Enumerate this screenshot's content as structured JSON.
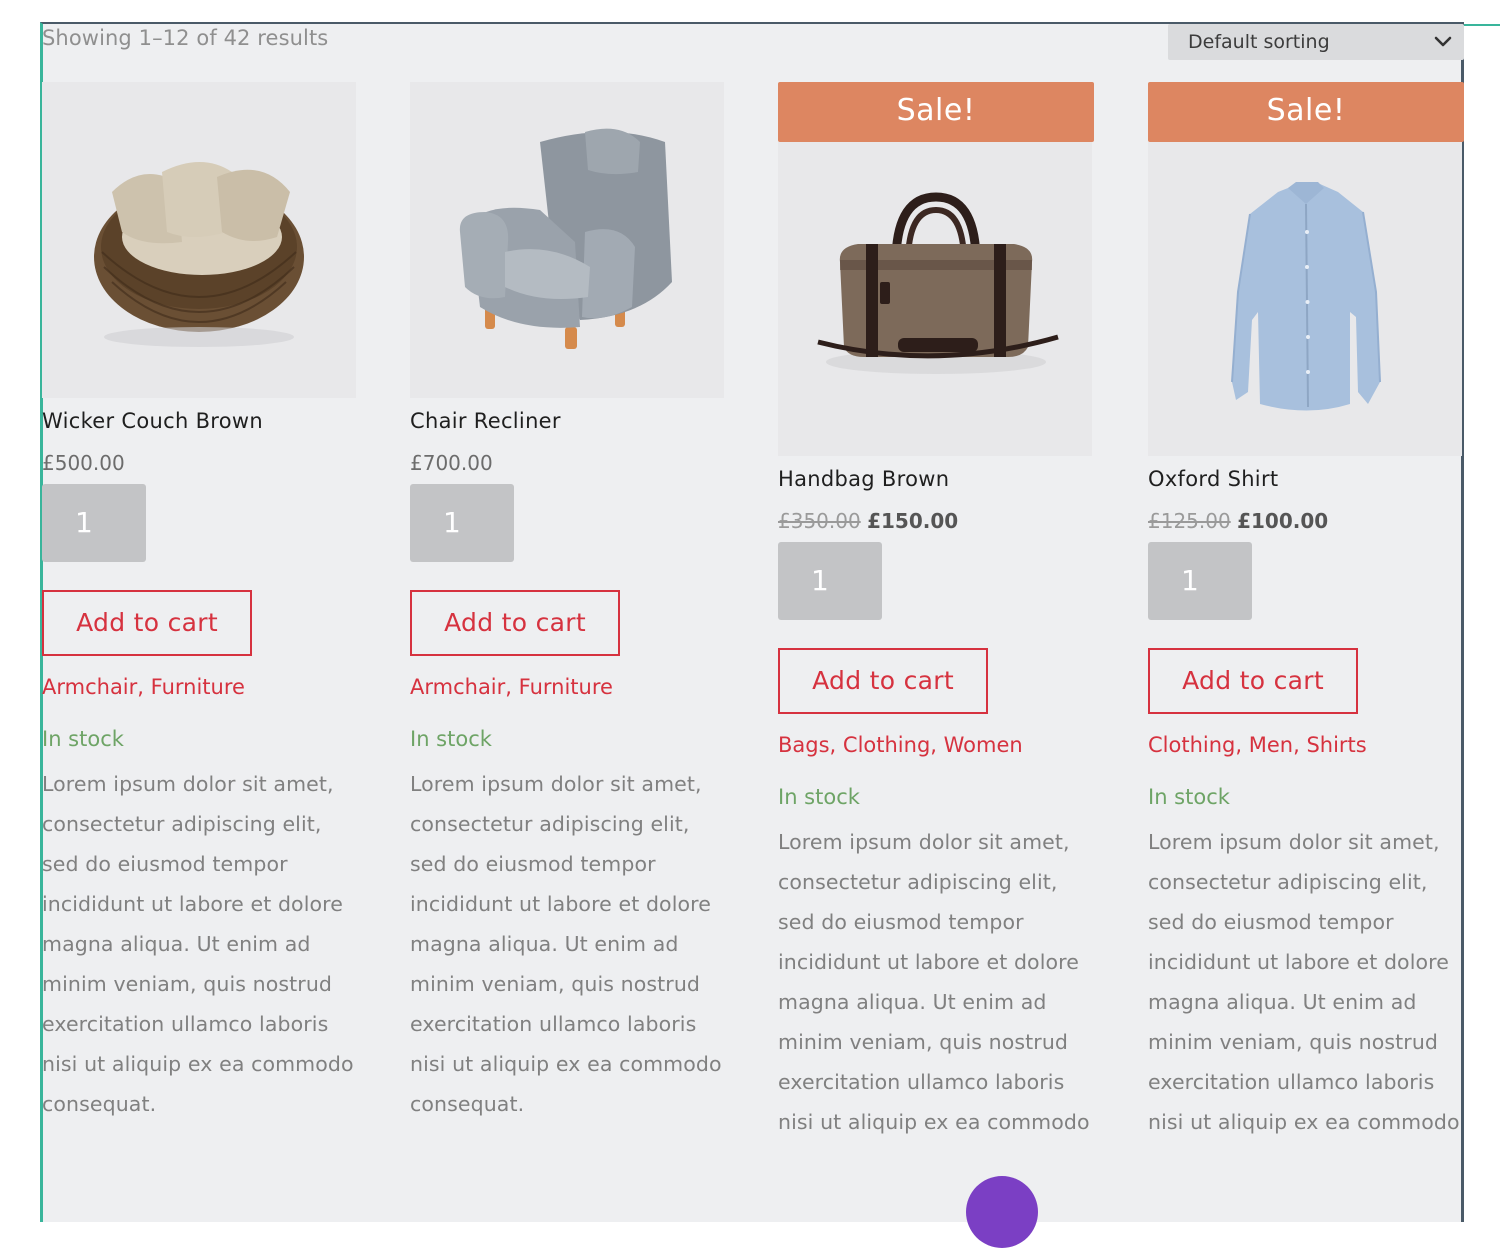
{
  "header": {
    "result_count": "Showing 1–12 of 42 results",
    "sort_selected": "Default sorting"
  },
  "products": [
    {
      "name": "Wicker Couch Brown",
      "price": "£500.00",
      "old_price": "",
      "sale_badge": "",
      "quantity": "1",
      "add_to_cart": "Add to cart",
      "categories": [
        "Armchair",
        "Furniture"
      ],
      "stock": "In stock",
      "description": "Lorem ipsum dolor sit amet, consectetur adipiscing elit, sed do eiusmod tempor incididunt ut labore et dolore magna aliqua. Ut enim ad minim veniam, quis nostrud exercitation ullamco laboris nisi ut aliquip ex ea commodo consequat."
    },
    {
      "name": "Chair Recliner",
      "price": "£700.00",
      "old_price": "",
      "sale_badge": "",
      "quantity": "1",
      "add_to_cart": "Add to cart",
      "categories": [
        "Armchair",
        "Furniture"
      ],
      "stock": "In stock",
      "description": "Lorem ipsum dolor sit amet, consectetur adipiscing elit, sed do eiusmod tempor incididunt ut labore et dolore magna aliqua. Ut enim ad minim veniam, quis nostrud exercitation ullamco laboris nisi ut aliquip ex ea commodo consequat."
    },
    {
      "name": "Handbag Brown",
      "price": "£150.00",
      "old_price": "£350.00",
      "sale_badge": "Sale!",
      "quantity": "1",
      "add_to_cart": "Add to cart",
      "categories": [
        "Bags",
        "Clothing",
        "Women"
      ],
      "stock": "In stock",
      "description": "Lorem ipsum dolor sit amet, consectetur adipiscing elit, sed do eiusmod tempor incididunt ut labore et dolore magna aliqua. Ut enim ad minim veniam, quis nostrud exercitation ullamco laboris nisi ut aliquip ex ea commodo"
    },
    {
      "name": "Oxford Shirt",
      "price": "£100.00",
      "old_price": "£125.00",
      "sale_badge": "Sale!",
      "quantity": "1",
      "add_to_cart": "Add to cart",
      "categories": [
        "Clothing",
        "Men",
        "Shirts"
      ],
      "stock": "In stock",
      "description": "Lorem ipsum dolor sit amet, consectetur adipiscing elit, sed do eiusmod tempor incididunt ut labore et dolore magna aliqua. Ut enim ad minim veniam, quis nostrud exercitation ullamco laboris nisi ut aliquip ex ea commodo"
    }
  ],
  "colors": {
    "accent": "#d6323f",
    "sale_badge": "#dd8661",
    "in_stock": "#6ea466",
    "page_bg": "#eeeff1"
  },
  "icons": {
    "sort_dropdown": "chevron-down-icon",
    "floating_button": "purple-circle"
  }
}
